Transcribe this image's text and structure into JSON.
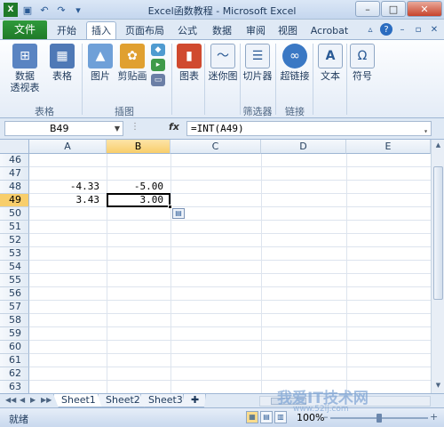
{
  "window": {
    "title": "Excel函数教程 - Microsoft Excel"
  },
  "ribbon": {
    "file_tab": "文件",
    "tabs": [
      "开始",
      "插入",
      "页面布局",
      "公式",
      "数据",
      "审阅",
      "视图",
      "Acrobat"
    ],
    "buttons": {
      "pivot": "数据\n透视表",
      "table": "表格",
      "picture": "图片",
      "clipart": "剪贴画",
      "chart": "图表",
      "sparkline": "迷你图",
      "slicer": "切片器",
      "hyperlink": "超链接",
      "text": "文本",
      "symbol": "符号"
    },
    "groups": {
      "tables": "表格",
      "illustrations": "插图",
      "filter": "筛选器",
      "links": "链接"
    }
  },
  "formula_bar": {
    "name_box": "B49",
    "fx": "fx",
    "formula": "=INT(A49)"
  },
  "sheet": {
    "columns": [
      "A",
      "B",
      "C",
      "D",
      "E"
    ],
    "selected_column": "B",
    "rows": [
      "46",
      "47",
      "48",
      "49",
      "50",
      "51",
      "52",
      "53",
      "54",
      "55",
      "56",
      "57",
      "58",
      "59",
      "60",
      "61",
      "62",
      "63"
    ],
    "selected_row": "49",
    "cells": {
      "A48": "-4.33",
      "B48": "-5.00",
      "A49": "3.43",
      "B49": "3.00"
    }
  },
  "sheet_tabs": [
    "Sheet1",
    "Sheet2",
    "Sheet3"
  ],
  "status": {
    "ready": "就绪",
    "zoom": "100%"
  },
  "watermark": {
    "text": "我爱IT技术网",
    "url": "www.52ij.com"
  }
}
